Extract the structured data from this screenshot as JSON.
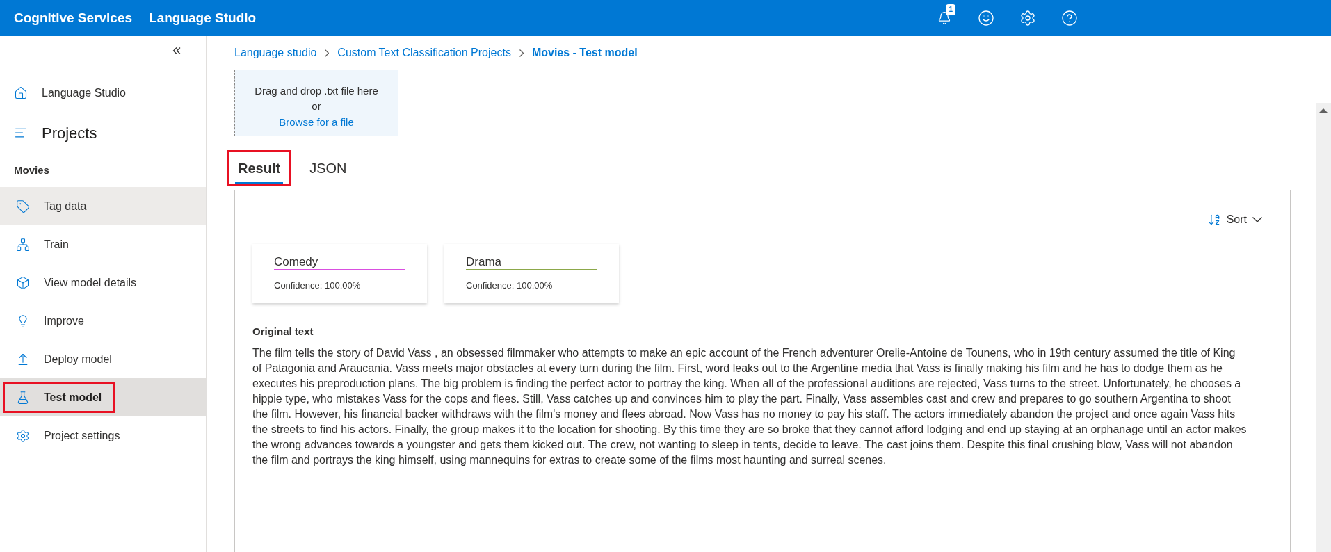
{
  "top_bar": {
    "brand": "Cognitive Services",
    "product": "Language Studio",
    "notification_count": "1"
  },
  "sidebar": {
    "home": "Language Studio",
    "projects": "Projects",
    "project_name": "Movies",
    "items": [
      {
        "label": "Tag data",
        "selected": false,
        "hovered": true,
        "annotated": false
      },
      {
        "label": "Train",
        "selected": false,
        "hovered": false,
        "annotated": false
      },
      {
        "label": "View model details",
        "selected": false,
        "hovered": false,
        "annotated": false
      },
      {
        "label": "Improve",
        "selected": false,
        "hovered": false,
        "annotated": false
      },
      {
        "label": "Deploy model",
        "selected": false,
        "hovered": false,
        "annotated": false
      },
      {
        "label": "Test model",
        "selected": true,
        "hovered": false,
        "annotated": true
      },
      {
        "label": "Project settings",
        "selected": false,
        "hovered": false,
        "annotated": false
      }
    ]
  },
  "breadcrumb": [
    {
      "label": "Language studio",
      "current": false
    },
    {
      "label": "Custom Text Classification Projects",
      "current": false
    },
    {
      "label": "Movies - Test model",
      "current": true
    }
  ],
  "upload": {
    "text": "Drag and drop .txt file here",
    "or": "or",
    "link": "Browse for a file"
  },
  "tabs": [
    {
      "label": "Result",
      "selected": true,
      "annotated": true
    },
    {
      "label": "JSON",
      "selected": false,
      "annotated": false
    }
  ],
  "result": {
    "sort": "Sort",
    "classes": [
      {
        "name": "Comedy",
        "confidence": "Confidence: 100.00%",
        "color": "#d94fe0"
      },
      {
        "name": "Drama",
        "confidence": "Confidence: 100.00%",
        "color": "#8ca84a"
      }
    ],
    "original_text_title": "Original text",
    "original_text": "The film tells the story of David Vass , an obsessed filmmaker who attempts to make an epic account of the French adventurer Orelie-Antoine de Tounens, who in 19th century assumed the title of King of Patagonia and Araucania. Vass meets major obstacles at every turn during the film. First, word leaks out to the Argentine media that Vass is finally making his film and he has to dodge them as he executes his preproduction plans. The big problem is finding the perfect actor to portray the king. When all of the professional auditions are rejected, Vass turns to the street. Unfortunately, he chooses a hippie type, who mistakes Vass for the cops and flees. Still, Vass catches up and convinces him to play the part. Finally, Vass assembles cast and crew and prepares to go southern Argentina to shoot the film. However, his financial backer withdraws with the film's money and flees abroad. Now Vass has no money to pay his staff. The actors immediately abandon the project and once again Vass hits the streets to find his actors. Finally, the group makes it to the location for shooting. By this time they are so broke that they cannot afford lodging and end up staying at an orphanage until an actor makes the wrong advances towards a youngster and gets them kicked out. The crew, not wanting to sleep in tents, decide to leave. The cast joins them. Despite this final crushing blow, Vass will not abandon the film and portrays the king himself, using mannequins for extras to create some of the films most haunting and surreal scenes."
  }
}
